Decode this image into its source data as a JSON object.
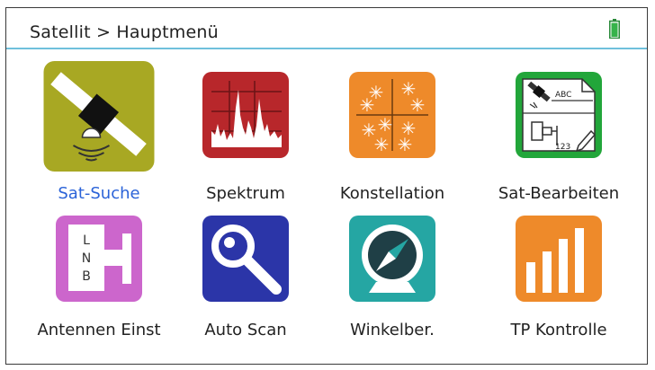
{
  "header": {
    "breadcrumb": "Satellit > Hauptmenü",
    "battery_icon": "battery-full-icon",
    "battery_color": "#36b34a"
  },
  "menu": {
    "items": [
      {
        "label": "Sat-Suche",
        "icon": "satellite-search-icon",
        "selected": true,
        "color": "#a8a823"
      },
      {
        "label": "Spektrum",
        "icon": "spectrum-icon",
        "selected": false,
        "color": "#b8272b"
      },
      {
        "label": "Konstellation",
        "icon": "constellation-icon",
        "selected": false,
        "color": "#ee8a2a"
      },
      {
        "label": "Sat-Bearbeiten",
        "icon": "sat-edit-icon",
        "selected": false,
        "color": "#22a63a"
      },
      {
        "label": "Antennen Einst",
        "icon": "lnb-antenna-icon",
        "selected": false,
        "color": "#cc66cc"
      },
      {
        "label": "Auto Scan",
        "icon": "magnifier-icon",
        "selected": false,
        "color": "#2b35a8"
      },
      {
        "label": "Winkelber.",
        "icon": "compass-icon",
        "selected": false,
        "color": "#25a6a3"
      },
      {
        "label": "TP Kontrolle",
        "icon": "bar-chart-icon",
        "selected": false,
        "color": "#ee8a2a"
      }
    ]
  },
  "icon_text": {
    "lnb_l": "L",
    "lnb_n": "N",
    "lnb_b": "B",
    "abc": "ABC",
    "num": "123"
  }
}
